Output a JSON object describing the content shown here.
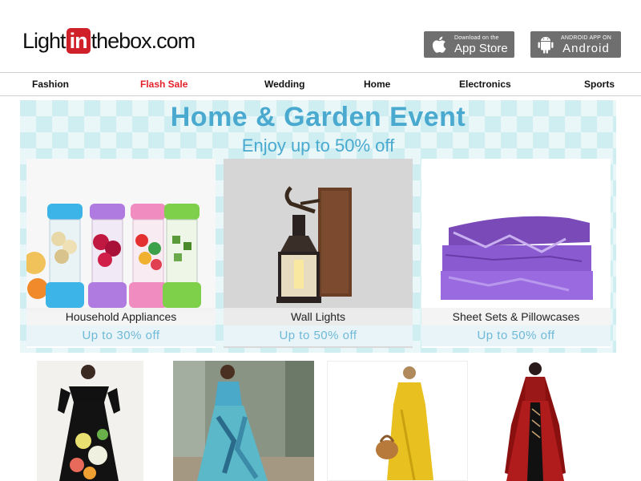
{
  "header": {
    "logo": {
      "pre": "Light",
      "mid": "in",
      "post": "thebox.com"
    },
    "appstore": {
      "small": "Download on the",
      "big": "App Store"
    },
    "android": {
      "small": "ANDROID APP ON",
      "big": "Android"
    }
  },
  "nav": {
    "items": [
      {
        "label": "Fashion"
      },
      {
        "label": "Flash Sale"
      },
      {
        "label": "Wedding"
      },
      {
        "label": "Home"
      },
      {
        "label": "Electronics"
      },
      {
        "label": "Sports"
      }
    ]
  },
  "banner": {
    "title": "Home & Garden Event",
    "subtitle": "Enjoy up to 50% off",
    "cards": [
      {
        "label": "Household Appliances",
        "discount": "Up to 30% off"
      },
      {
        "label": "Wall Lights",
        "discount": "Up to 50% off"
      },
      {
        "label": "Sheet Sets & Pillowcases",
        "discount": "Up to 50% off"
      }
    ]
  },
  "colors": {
    "sale": "#e4202a",
    "banner_text": "#4aa9cf",
    "logo_red": "#d0202a"
  }
}
